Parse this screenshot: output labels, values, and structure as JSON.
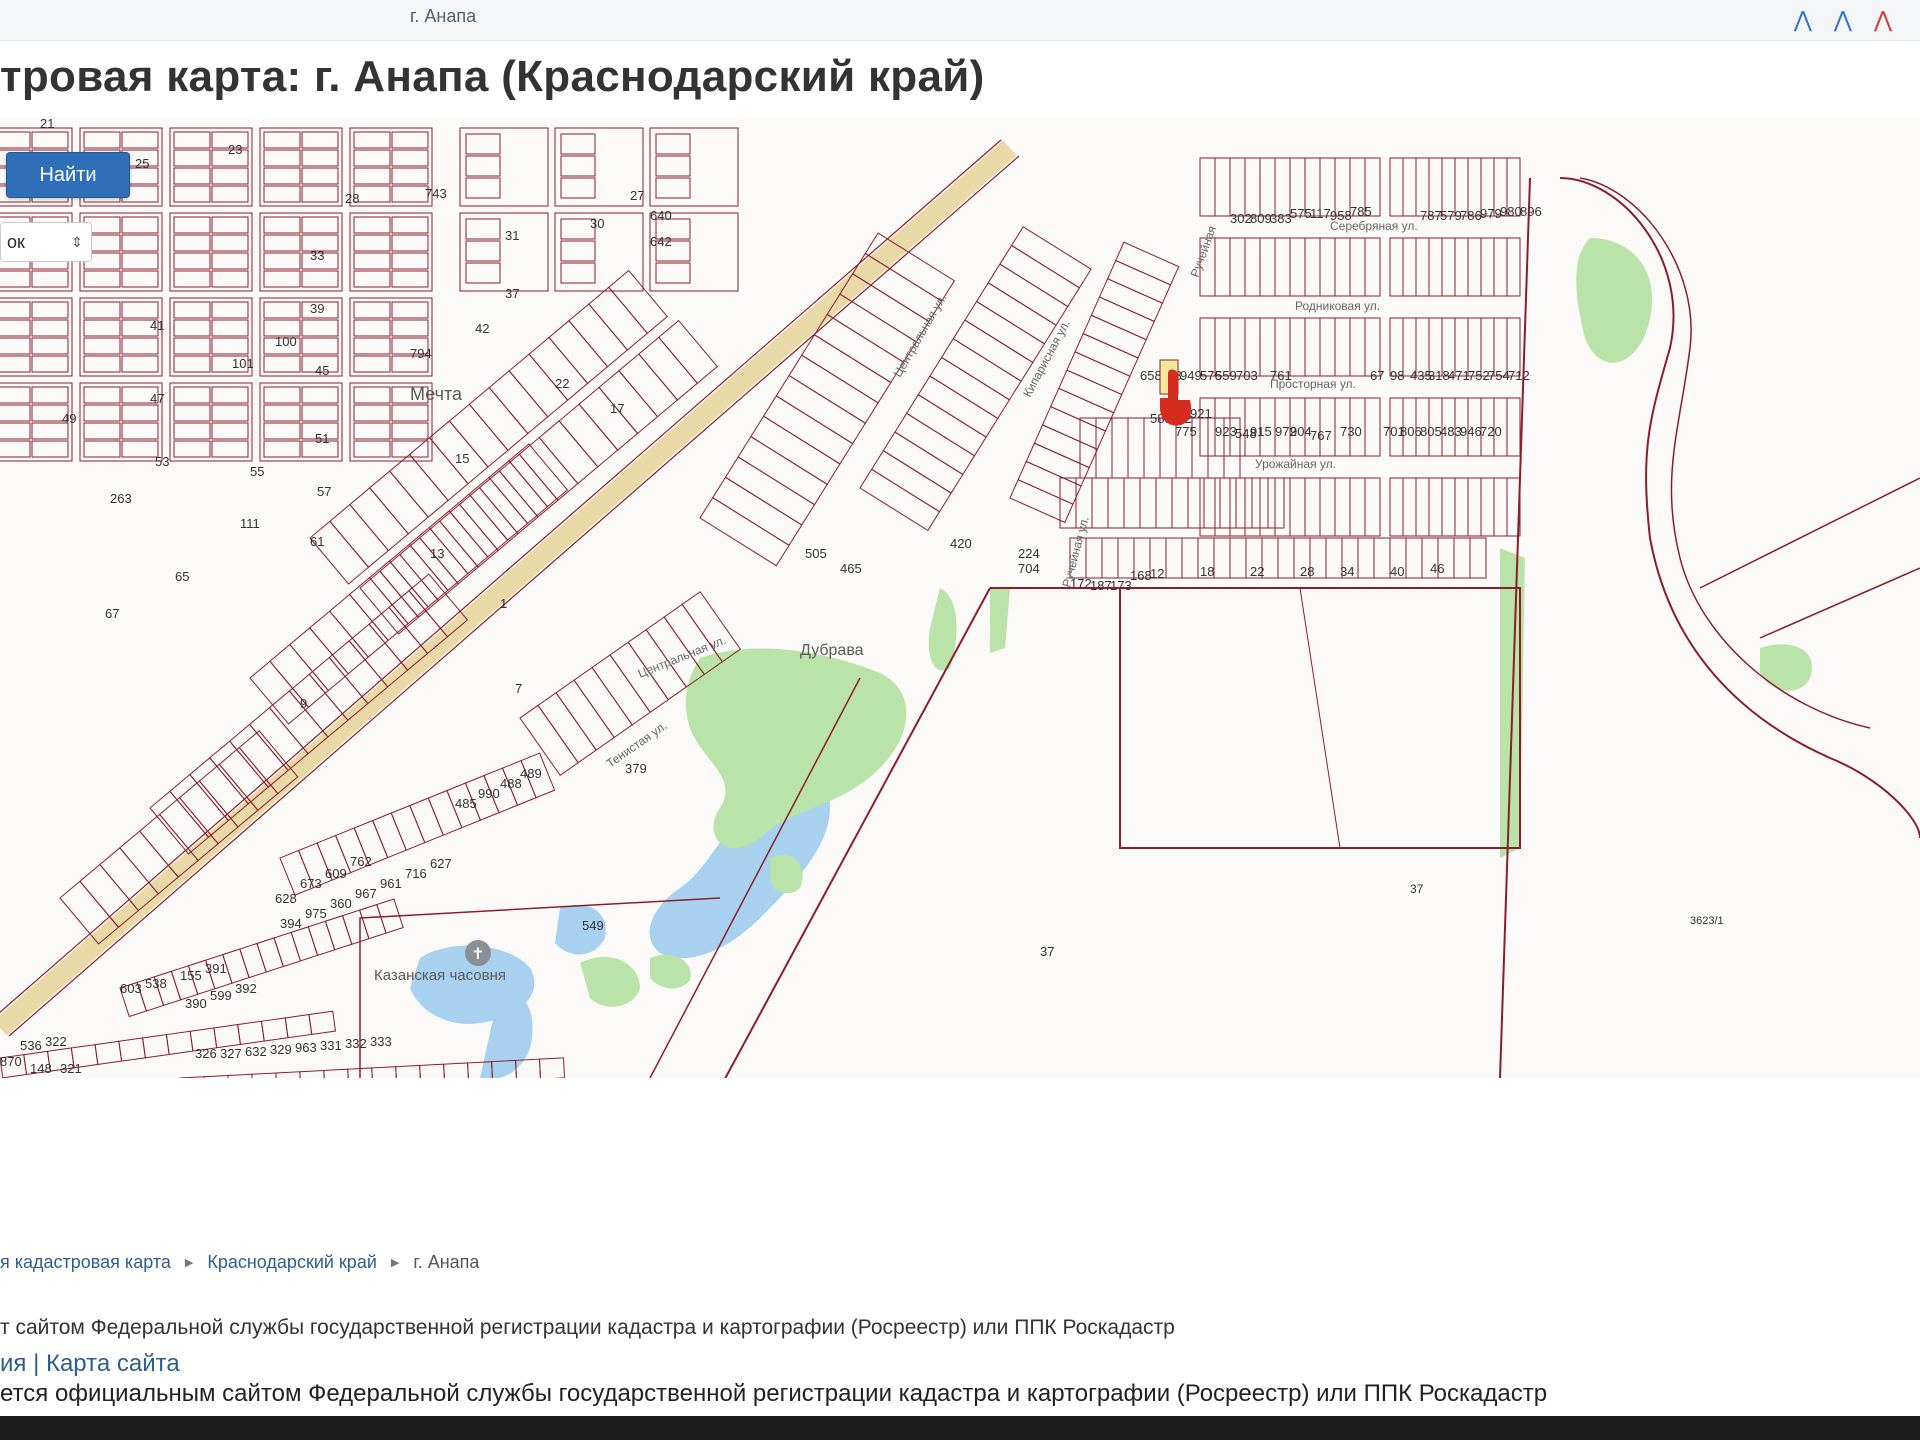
{
  "header": {
    "crumb": "г. Анапа",
    "title": "тровая карта: г. Анапа (Краснодарский край)"
  },
  "search": {
    "find_label": "Найти",
    "select_value": "ок"
  },
  "map": {
    "place_labels": [
      "Мечта",
      "Дубрава",
      "Казанская часовня"
    ],
    "street_labels": [
      "Центральная ул.",
      "Центральная ул.",
      "Серебряная ул.",
      "Родниковая ул.",
      "Просторная ул.",
      "Урожайная ул.",
      "Ручейная",
      "Ручейная ул.",
      "Кипарисная ул.",
      "Тенистая ул."
    ],
    "parcel_numbers": [
      "743",
      "640",
      "642",
      "27",
      "30",
      "794",
      "42",
      "101",
      "100",
      "45",
      "51",
      "57",
      "263",
      "111",
      "61",
      "65",
      "67",
      "53",
      "55",
      "49",
      "47",
      "41",
      "39",
      "33",
      "31",
      "37",
      "28",
      "25",
      "23",
      "21",
      "22",
      "17",
      "15",
      "13",
      "9",
      "1",
      "7",
      "505",
      "465",
      "420",
      "224",
      "704",
      "187",
      "173",
      "168",
      "172",
      "12",
      "18",
      "22",
      "28",
      "34",
      "40",
      "46",
      "589",
      "432",
      "921",
      "775",
      "923",
      "548",
      "915",
      "972",
      "904",
      "767",
      "730",
      "658",
      "918",
      "949",
      "576",
      "559",
      "703",
      "761",
      "302",
      "809",
      "383",
      "575",
      "117",
      "958",
      "785",
      "787",
      "579",
      "786",
      "979",
      "980",
      "896",
      "701",
      "806",
      "805",
      "483",
      "946",
      "720",
      "67",
      "98",
      "435",
      "318",
      "471",
      "752",
      "754",
      "712",
      "549",
      "37",
      "3623/1",
      "628",
      "673",
      "609",
      "762",
      "485",
      "990",
      "488",
      "489",
      "394",
      "975",
      "360",
      "967",
      "961",
      "716",
      "627",
      "603",
      "538",
      "155",
      "391",
      "390",
      "599",
      "392",
      "326",
      "327",
      "632",
      "329",
      "963",
      "331",
      "332",
      "333",
      "536",
      "322",
      "870",
      "148",
      "321",
      "379"
    ]
  },
  "breadcrumb": {
    "item1": "я кадастровая карта",
    "item2": "Краснодарский край",
    "item3": "г. Анапа"
  },
  "footer": {
    "note": "т сайтом Федеральной службы государственной регистрации кадастра и картографии (Росреестр) или ППК Роскадастр",
    "links": "ия | Карта сайта",
    "official": "ется официальным сайтом Федеральной службы государственной регистрации кадастра и картографии (Росреестр) или ППК Роскадастр"
  },
  "colors": {
    "parcel_line": "#8b1e2b",
    "road": "#e9d9a6",
    "greenery": "#b9e3a8",
    "water": "#a8d1f0",
    "button": "#2f6fb8"
  }
}
